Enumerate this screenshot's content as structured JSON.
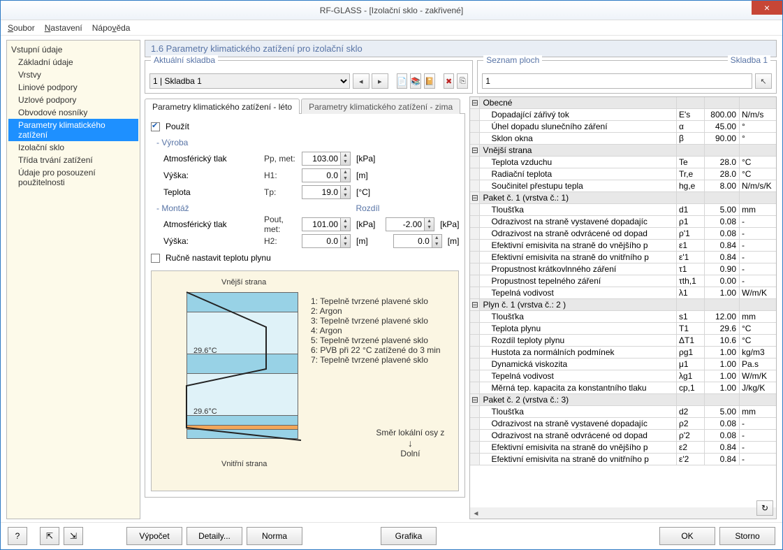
{
  "title": "RF-GLASS - [Izolační sklo - zakřivené]",
  "menu": {
    "soubor": "Soubor",
    "nastaveni": "Nastavení",
    "napoveda": "Nápověda"
  },
  "tree": {
    "header": "Vstupní údaje",
    "items": [
      {
        "label": "Základní údaje"
      },
      {
        "label": "Vrstvy"
      },
      {
        "label": "Liniové podpory"
      },
      {
        "label": "Uzlové podpory"
      },
      {
        "label": "Obvodové nosníky"
      },
      {
        "label": "Parametry klimatického zatížení",
        "selected": true
      },
      {
        "label": "Izolační sklo"
      },
      {
        "label": "Třída trvání zatížení"
      },
      {
        "label": "Údaje pro posouzení použitelnosti"
      }
    ]
  },
  "panetitle": "1.6 Parametry klimatického zatížení pro izolační sklo",
  "aktualni": {
    "legend": "Aktuální skladba",
    "combo": "1 | Skladba 1"
  },
  "seznam": {
    "legend": "Seznam ploch",
    "right": "Skladba 1",
    "value": "1"
  },
  "tabs": {
    "leto": "Parametry klimatického zatížení - léto",
    "zima": "Parametry klimatického zatížení - zima"
  },
  "form": {
    "pouzit": "Použít",
    "vyroba": "- Výroba",
    "atm": "Atmosférický tlak",
    "atm_sym": "Pp, met:",
    "atm_val": "103.00",
    "atm_unit": "[kPa]",
    "vyska": "Výška:",
    "vyska_sym": "H1:",
    "vyska_val": "0.0",
    "vyska_unit": "[m]",
    "teplota": "Teplota",
    "teplota_sym": "Tp:",
    "teplota_val": "19.0",
    "teplota_unit": "[°C]",
    "montaz": "- Montáž",
    "rozdil": "Rozdíl",
    "atm2": "Atmosférický tlak",
    "atm2_sym": "Pout, met:",
    "atm2_val": "101.00",
    "atm2_unit": "[kPa]",
    "rozdil_atm": "-2.00",
    "rozdil_atm_unit": "[kPa]",
    "vyska2": "Výška:",
    "vyska2_sym": "H2:",
    "vyska2_val": "0.0",
    "vyska2_unit": "[m]",
    "rozdil_vyska": "0.0",
    "rozdil_vyska_unit": "[m]",
    "rucne": "Ručně nastavit teplotu plynu"
  },
  "diagram": {
    "vnejsi": "Vnější strana",
    "vnitrni": "Vnitřní strana",
    "t1": "29.6°C",
    "t2": "29.6°C",
    "layers": [
      "1: Tepelně tvrzené plavené sklo",
      "2: Argon",
      "3: Tepelně tvrzené plavené sklo",
      "4: Argon",
      "5: Tepelně tvrzené plavené sklo",
      "6: PVB při 22 °C zatížené do 3 min",
      "7: Tepelně tvrzené plavené sklo"
    ],
    "smer": "Směr lokální osy z",
    "dolni": "Dolní"
  },
  "props": [
    {
      "group": "Obecné"
    },
    {
      "name": "Dopadající zářivý tok",
      "sym": "E's",
      "val": "800.00",
      "unit": "N/m/s"
    },
    {
      "name": "Úhel dopadu slunečního záření",
      "sym": "α",
      "val": "45.00",
      "unit": "°"
    },
    {
      "name": "Sklon okna",
      "sym": "β",
      "val": "90.00",
      "unit": "°"
    },
    {
      "group": "Vnější strana"
    },
    {
      "name": "Teplota vzduchu",
      "sym": "Te",
      "val": "28.0",
      "unit": "°C"
    },
    {
      "name": "Radiační teplota",
      "sym": "Tr,e",
      "val": "28.0",
      "unit": "°C"
    },
    {
      "name": "Součinitel přestupu tepla",
      "sym": "hg,e",
      "val": "8.00",
      "unit": "N/m/s/K"
    },
    {
      "group": "Paket č. 1 (vrstva č.: 1)"
    },
    {
      "name": "Tloušťka",
      "sym": "d1",
      "val": "5.00",
      "unit": "mm"
    },
    {
      "name": "Odrazivost na straně vystavené dopadajíc",
      "sym": "ρ1",
      "val": "0.08",
      "unit": "-"
    },
    {
      "name": "Odrazivost na straně odvrácené od dopad",
      "sym": "ρ'1",
      "val": "0.08",
      "unit": "-"
    },
    {
      "name": "Efektivní emisivita na straně do vnějšího p",
      "sym": "ε1",
      "val": "0.84",
      "unit": "-"
    },
    {
      "name": "Efektivní emisivita na straně do vnitřního p",
      "sym": "ε'1",
      "val": "0.84",
      "unit": "-"
    },
    {
      "name": "Propustnost krátkovlnného záření",
      "sym": "τ1",
      "val": "0.90",
      "unit": "-"
    },
    {
      "name": "Propustnost tepelného záření",
      "sym": "τth,1",
      "val": "0.00",
      "unit": "-"
    },
    {
      "name": "Tepelná vodivost",
      "sym": "λ1",
      "val": "1.00",
      "unit": "W/m/K"
    },
    {
      "group": "Plyn č. 1 (vrstva č.: 2 )"
    },
    {
      "name": "Tloušťka",
      "sym": "s1",
      "val": "12.00",
      "unit": "mm"
    },
    {
      "name": "Teplota plynu",
      "sym": "T1",
      "val": "29.6",
      "unit": "°C"
    },
    {
      "name": "Rozdíl teploty plynu",
      "sym": "ΔT1",
      "val": "10.6",
      "unit": "°C"
    },
    {
      "name": "Hustota za normálních podmínek",
      "sym": "ρg1",
      "val": "1.00",
      "unit": "kg/m3"
    },
    {
      "name": "Dynamická viskozita",
      "sym": "μ1",
      "val": "1.00",
      "unit": "Pa.s"
    },
    {
      "name": "Tepelná vodivost",
      "sym": "λg1",
      "val": "1.00",
      "unit": "W/m/K"
    },
    {
      "name": "Měrná tep. kapacita za konstantního tlaku",
      "sym": "cp,1",
      "val": "1.00",
      "unit": "J/kg/K"
    },
    {
      "group": "Paket č. 2 (vrstva č.: 3)"
    },
    {
      "name": "Tloušťka",
      "sym": "d2",
      "val": "5.00",
      "unit": "mm"
    },
    {
      "name": "Odrazivost na straně vystavené dopadajíc",
      "sym": "ρ2",
      "val": "0.08",
      "unit": "-"
    },
    {
      "name": "Odrazivost na straně odvrácené od dopad",
      "sym": "ρ'2",
      "val": "0.08",
      "unit": "-"
    },
    {
      "name": "Efektivní emisivita na straně do vnějšího p",
      "sym": "ε2",
      "val": "0.84",
      "unit": "-"
    },
    {
      "name": "Efektivní emisivita na straně do vnitřního p",
      "sym": "ε'2",
      "val": "0.84",
      "unit": "-"
    }
  ],
  "buttons": {
    "vypocet": "Výpočet",
    "detaily": "Detaily...",
    "norma": "Norma",
    "grafika": "Grafika",
    "ok": "OK",
    "storno": "Storno"
  }
}
